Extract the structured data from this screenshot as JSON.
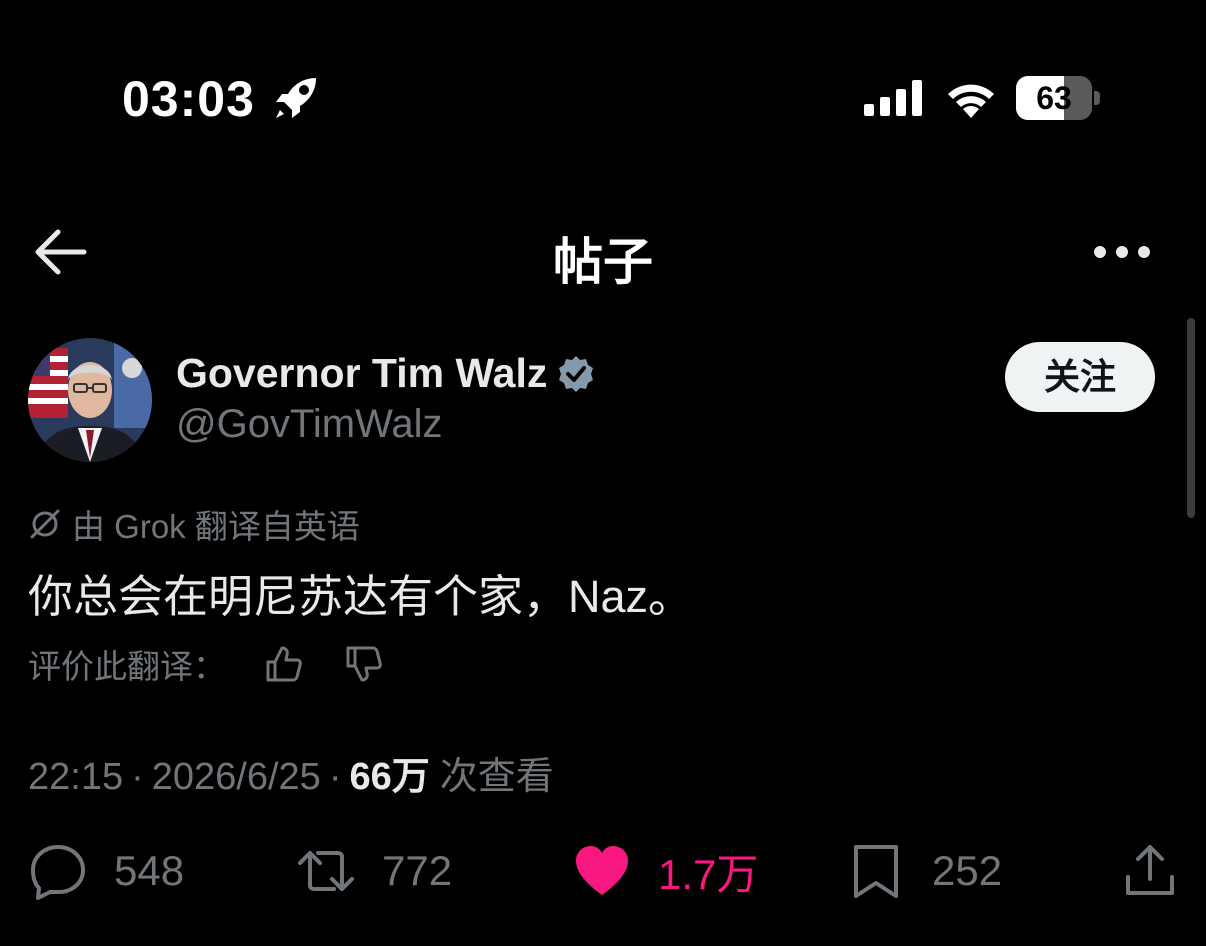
{
  "status_bar": {
    "time": "03:03",
    "battery_label": "63",
    "battery_level": 0.63,
    "icons": [
      "rocket-icon",
      "cellular-signal-icon",
      "wifi-icon",
      "battery-icon"
    ]
  },
  "nav": {
    "title": "帖子",
    "back_icon": "arrow-left-icon",
    "more_icon": "more-horizontal-icon"
  },
  "post": {
    "author_name": "Governor Tim Walz",
    "handle": "@GovTimWalz",
    "verified_badge": "verified-badge-icon",
    "follow_label": "关注",
    "translation_label": "由 Grok 翻译自英语",
    "text": "你总会在明尼苏达有个家，Naz。",
    "rate_label": "评价此翻译：",
    "time": "22:15",
    "date": "2026/6/25",
    "views_count": "66万",
    "views_label": "次查看"
  },
  "actions": {
    "replies": "548",
    "reposts": "772",
    "likes": "1.7万",
    "bookmarks": "252",
    "liked": true
  },
  "colors": {
    "background": "#000000",
    "text_primary": "#e7e9ea",
    "text_secondary": "#71767b",
    "like": "#f91880",
    "verified_badge": "#829aab",
    "follow_bg": "#eff3f4"
  }
}
